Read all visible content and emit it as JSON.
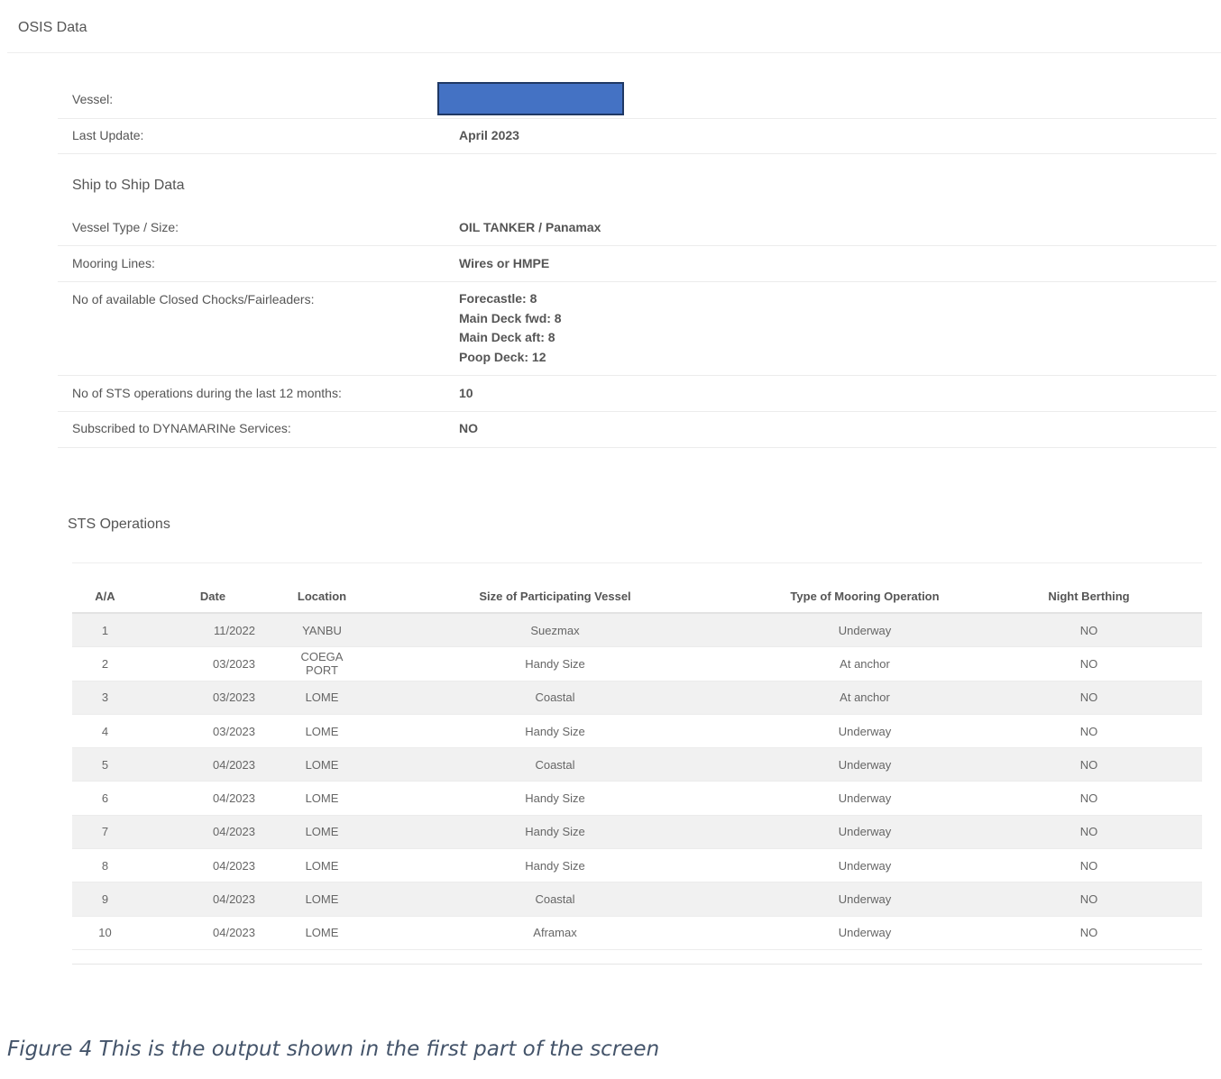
{
  "header": {
    "title": "OSIS Data"
  },
  "vessel_info": {
    "vessel_label": "Vessel:",
    "vessel_value": "",
    "last_update_label": "Last Update:",
    "last_update_value": "April 2023"
  },
  "sts_data": {
    "heading": "Ship to Ship Data",
    "vessel_type_label": "Vessel Type / Size:",
    "vessel_type_value": "OIL TANKER / Panamax",
    "mooring_lines_label": "Mooring Lines:",
    "mooring_lines_value": "Wires or HMPE",
    "chocks_label": "No of available Closed Chocks/Fairleaders:",
    "chocks_values": [
      "Forecastle: 8",
      "Main Deck fwd: 8",
      "Main Deck aft: 8",
      "Poop Deck: 12"
    ],
    "ops_count_label": "No of STS operations during the last 12 months:",
    "ops_count_value": "10",
    "subscribed_label": "Subscribed to DYNAMARINe Services:",
    "subscribed_value": "NO"
  },
  "sts_operations": {
    "heading": "STS Operations",
    "columns": [
      "A/A",
      "Date",
      "Location",
      "Size of Participating Vessel",
      "Type of Mooring Operation",
      "Night Berthing"
    ],
    "rows": [
      [
        "1",
        "11/2022",
        "YANBU",
        "Suezmax",
        "Underway",
        "NO"
      ],
      [
        "2",
        "03/2023",
        "COEGA PORT",
        "Handy Size",
        "At anchor",
        "NO"
      ],
      [
        "3",
        "03/2023",
        "LOME",
        "Coastal",
        "At anchor",
        "NO"
      ],
      [
        "4",
        "03/2023",
        "LOME",
        "Handy Size",
        "Underway",
        "NO"
      ],
      [
        "5",
        "04/2023",
        "LOME",
        "Coastal",
        "Underway",
        "NO"
      ],
      [
        "6",
        "04/2023",
        "LOME",
        "Handy Size",
        "Underway",
        "NO"
      ],
      [
        "7",
        "04/2023",
        "LOME",
        "Handy Size",
        "Underway",
        "NO"
      ],
      [
        "8",
        "04/2023",
        "LOME",
        "Handy Size",
        "Underway",
        "NO"
      ],
      [
        "9",
        "04/2023",
        "LOME",
        "Coastal",
        "Underway",
        "NO"
      ],
      [
        "10",
        "04/2023",
        "LOME",
        "Aframax",
        "Underway",
        "NO"
      ]
    ]
  },
  "caption": "Figure 4 This is the output shown in the first part of the screen",
  "colors": {
    "redaction_fill": "#4472c4",
    "redaction_border": "#1f3864",
    "caption_text": "#44546a",
    "row_stripe": "#f1f1f1"
  }
}
